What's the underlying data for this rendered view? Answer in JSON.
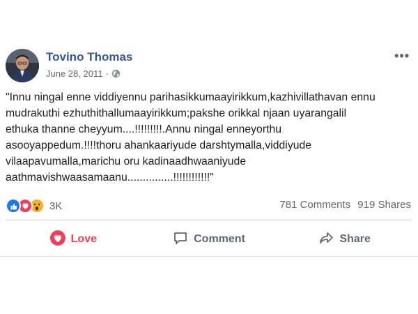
{
  "post": {
    "author": "Tovino Thomas",
    "date": "June 28, 2011",
    "separator": "·",
    "privacy_icon": "globe-icon",
    "more_icon": "more-options-icon",
    "more_label": "•••",
    "text": "\"Innu ningal enne viddiyennu parihasikkumaayirikkum,kazhivillathavan ennu\nmudrakuthi ezhuthithallumaayirikkum;pakshe orikkal njaan uyarangalil\nethuka thanne cheyyum....!!!!!!!!!.Annu ningal enneyorthu\nasooyappedum.!!!!thoru ahankaariyude darshtymalla,viddiyude\nvilaapavumalla,marichu oru kadinaadhwaaniyude\naathmavishwaasamaanu...............!!!!!!!!!!!!\""
  },
  "reactions": {
    "icons": [
      "like-icon",
      "love-icon",
      "wow-icon"
    ],
    "count": "3K",
    "comments": "781 Comments",
    "shares": "919 Shares"
  },
  "actions": {
    "love": "Love",
    "comment": "Comment",
    "share": "Share"
  },
  "colors": {
    "author": "#365899",
    "love": "#f33e58",
    "like": "#1877f2",
    "wow": "#f7b125",
    "secondary": "#616770"
  }
}
